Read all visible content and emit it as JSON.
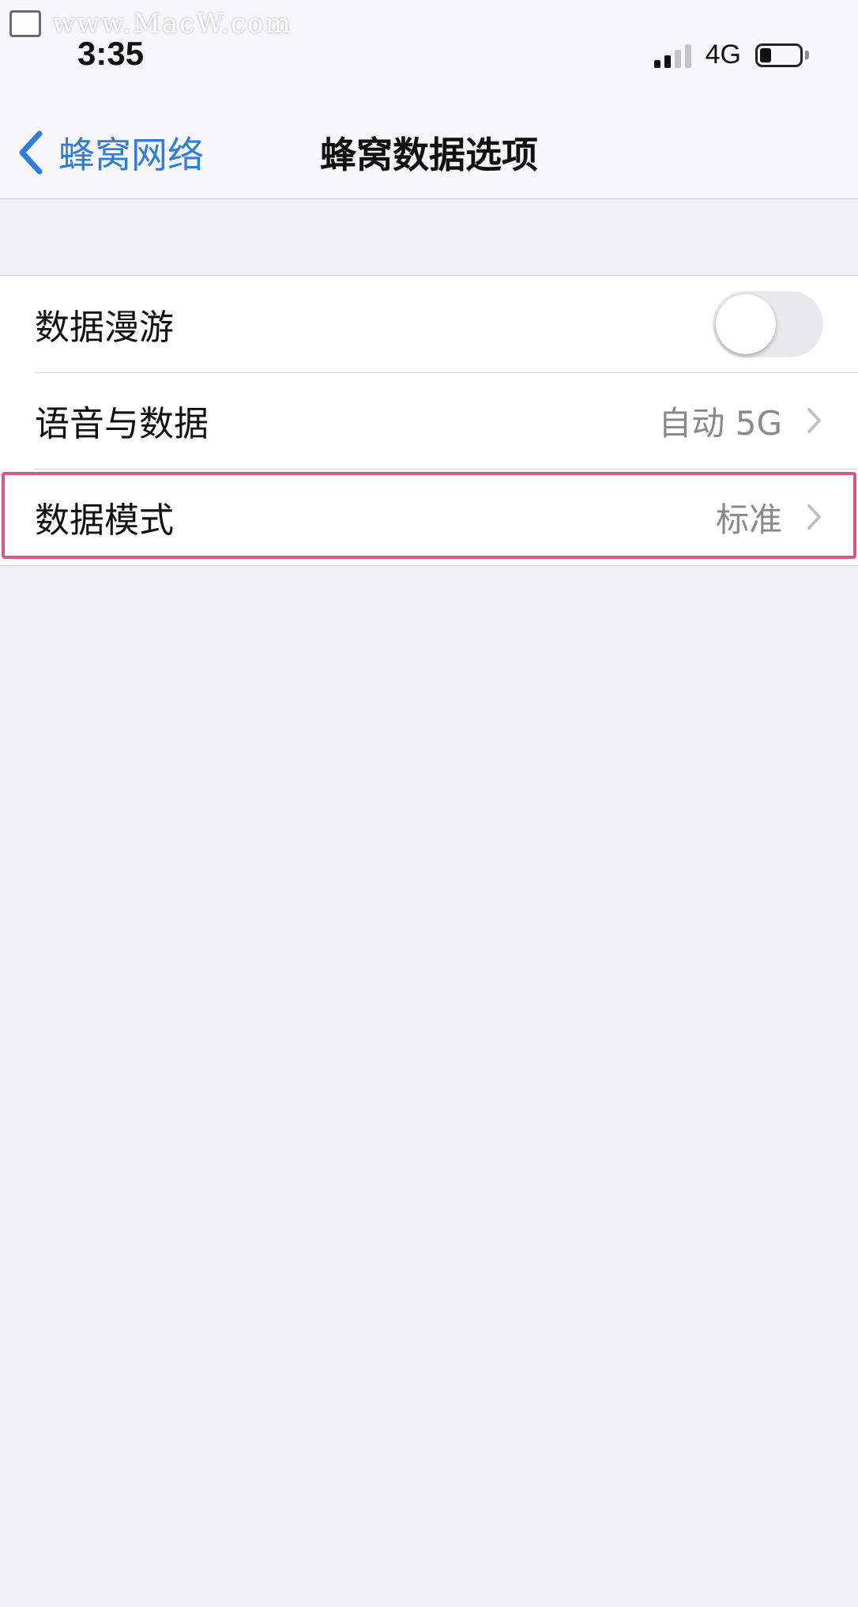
{
  "watermark": {
    "text": "www.MacW.com",
    "icon": "monitor-logo-icon"
  },
  "status_bar": {
    "time": "3:35",
    "network": "4G",
    "signal_bars_active": 2,
    "signal_bars_total": 4,
    "battery_level": 0.2
  },
  "nav": {
    "back_label": "蜂窝网络",
    "title": "蜂窝数据选项",
    "accent_color": "#2f7ce0"
  },
  "settings": {
    "data_roaming": {
      "label": "数据漫游",
      "enabled": false
    },
    "voice_data": {
      "label": "语音与数据",
      "value": "自动 5G"
    },
    "data_mode": {
      "label": "数据模式",
      "value": "标准",
      "highlight_color": "#d45985"
    }
  }
}
